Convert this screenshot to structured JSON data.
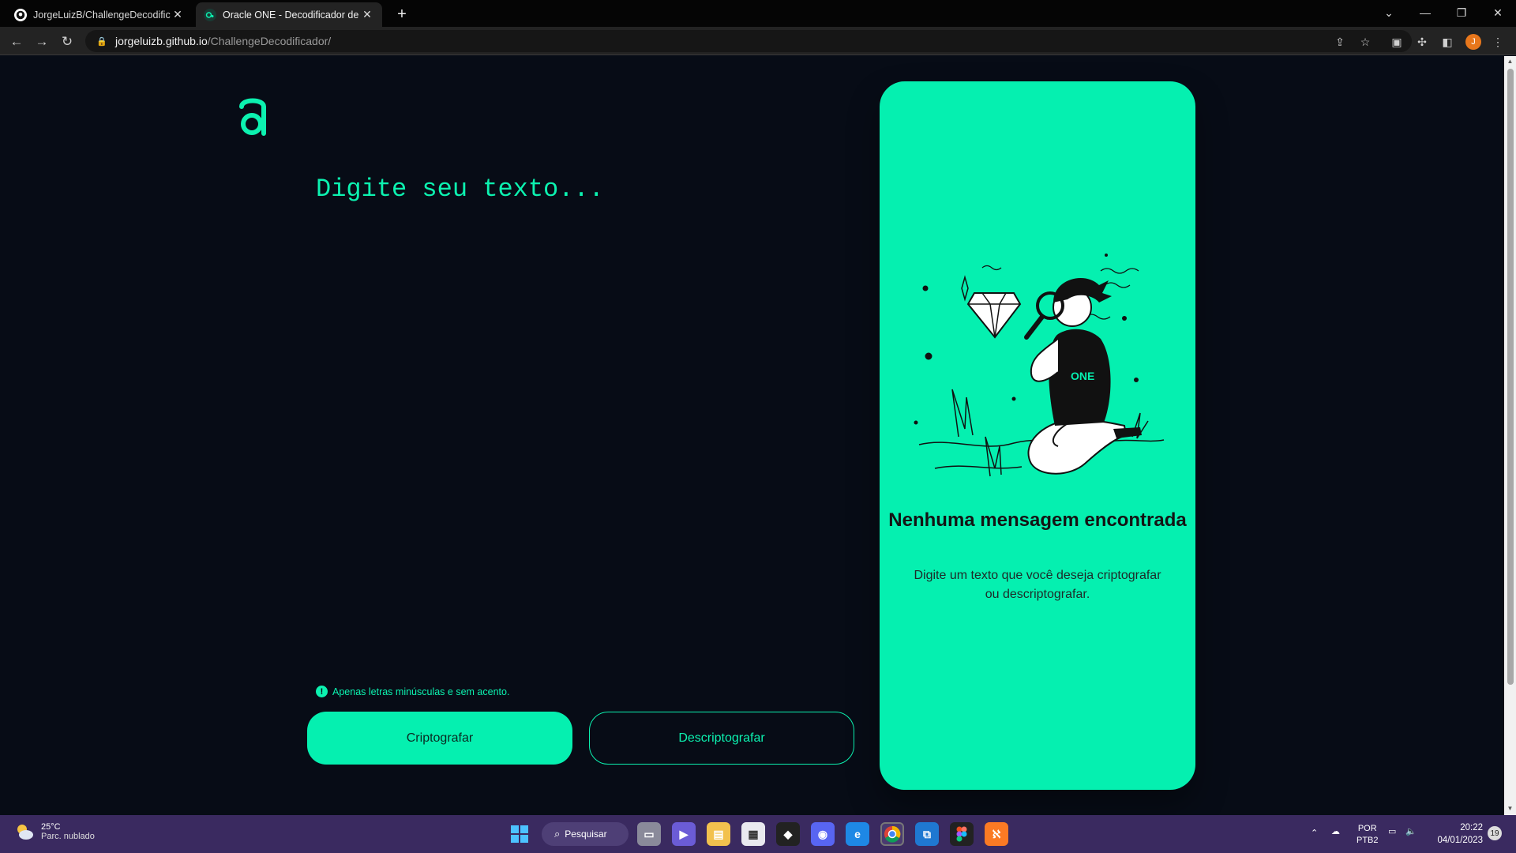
{
  "browser": {
    "tabs": [
      {
        "title": "JorgeLuizB/ChallengeDecodificador",
        "active": false
      },
      {
        "title": "Oracle ONE - Decodificador de Texto",
        "active": true
      }
    ],
    "url_host": "jorgeluizb.github.io",
    "url_path": "/ChallengeDecodificador/",
    "profile_initial": "J"
  },
  "app": {
    "placeholder": "Digite seu texto...",
    "hint": "Apenas letras minúsculas e sem acento.",
    "encrypt_label": "Criptografar",
    "decrypt_label": "Descriptografar",
    "output": {
      "title": "Nenhuma mensagem encontrada",
      "subtitle": "Digite um texto que você deseja criptografar ou descriptografar.",
      "shirt_text": "ONE"
    },
    "colors": {
      "accent": "#05f0b0",
      "background": "#070c16"
    }
  },
  "taskbar": {
    "weather_temp": "25°C",
    "weather_desc": "Parc. nublado",
    "search_label": "Pesquisar",
    "lang_top": "POR",
    "lang_bottom": "PTB2",
    "time": "20:22",
    "date": "04/01/2023",
    "notifications": "19"
  }
}
